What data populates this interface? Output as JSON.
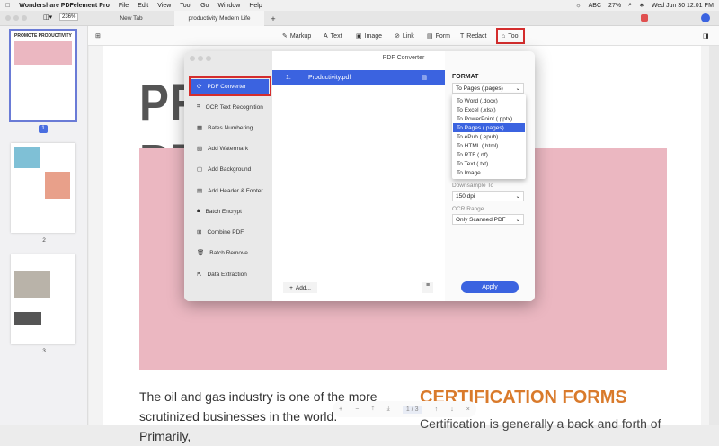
{
  "menubar": {
    "app": "Wondershare PDFelement Pro",
    "items": [
      "File",
      "Edit",
      "View",
      "Tool",
      "Go",
      "Window",
      "Help"
    ],
    "input": "ABC",
    "battery": "27%",
    "clock": "Wed Jun 30  12:01 PM"
  },
  "tabbar": {
    "zoom": "236%",
    "tabs": [
      "New Tab",
      "productivity Modern Life"
    ],
    "add": "+"
  },
  "toolbar": {
    "items": [
      "Markup",
      "Text",
      "Image",
      "Link",
      "Form",
      "Redact",
      "Tool"
    ]
  },
  "sidebar": {
    "pages": [
      "1",
      "2",
      "3"
    ],
    "thumb1_title": "PROMOTE PRODUCTIVITY"
  },
  "document": {
    "title": "PROMOTE PRODUCTIVITY",
    "body": "The oil and gas industry is one of the more scrutinized businesses in the world. Primarily,",
    "cert_title": "CERTIFICATION FORMS",
    "cert_body": "Certification is generally a back and forth of"
  },
  "findbar": {
    "page": "1",
    "sep": "/",
    "total": "3"
  },
  "dialog": {
    "title": "PDF Converter",
    "side_items": [
      "PDF Converter",
      "OCR Text Recognition",
      "Bates Numbering",
      "Add Watermark",
      "Add Background",
      "Add Header & Footer",
      "Batch Encrypt",
      "Combine PDF",
      "Batch Remove",
      "Data Extraction"
    ],
    "file": {
      "index": "1.",
      "name": "Productivity.pdf"
    },
    "add": "Add...",
    "format_label": "FORMAT",
    "format_value": "To Pages (.pages)",
    "format_options": [
      "To Word (.docx)",
      "To Excel (.xlsx)",
      "To PowerPoint (.pptx)",
      "To Pages (.pages)",
      "To ePub (.epub)",
      "To HTML (.html)",
      "To RTF (.rtf)",
      "To Text (.txt)",
      "To Image"
    ],
    "downsample_label": "Downsample To",
    "downsample_value": "150 dpi",
    "ocr_label": "OCR Range",
    "ocr_value": "Only Scanned PDF",
    "apply": "Apply"
  }
}
